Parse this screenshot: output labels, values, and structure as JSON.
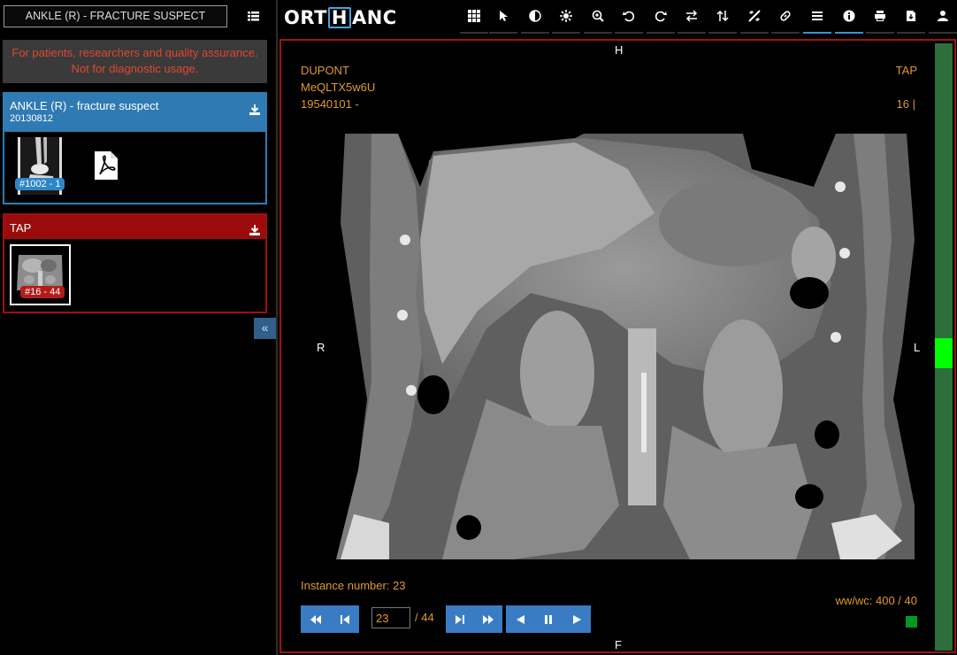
{
  "sidebar": {
    "study_title": "ANKLE (R) - FRACTURE SUSPECT",
    "disclaimer": "For patients, researchers and quality assurance. Not for diagnostic usage.",
    "studies": [
      {
        "description": "ANKLE (R) - fracture suspect",
        "date": "20130812",
        "color": "#2f7ab3",
        "series": [
          {
            "badge": "#1002 - 1",
            "kind": "x-ray-thumbnail"
          },
          {
            "badge": "",
            "kind": "pdf-icon"
          }
        ]
      },
      {
        "description": "TAP",
        "date": "",
        "color": "#9a0b0b",
        "series": [
          {
            "badge": "#16 - 44",
            "kind": "ct-thumbnail"
          }
        ]
      }
    ],
    "collapse_label": "«"
  },
  "toolbar": {
    "logo_left": "ORT",
    "logo_boxed": "H",
    "logo_right": "ANC",
    "tools": [
      "layout-grid-icon",
      "pointer-icon",
      "contrast-icon",
      "pan-icon",
      "zoom-icon",
      "rotate-left-icon",
      "rotate-right-icon",
      "flip-horizontal-icon",
      "flip-vertical-icon",
      "measure-icon",
      "link-icon",
      "menu-icon",
      "info-icon",
      "print-icon",
      "download-file-icon",
      "user-icon"
    ],
    "active_tools": [
      "menu-icon",
      "info-icon"
    ]
  },
  "viewer": {
    "orientation": {
      "top": "H",
      "bottom": "F",
      "left": "R",
      "right": "L"
    },
    "patient_name": "DUPONT",
    "patient_id": "MeQLTX5w6U",
    "birth_date": "19540101 -",
    "series_description": "TAP",
    "series_number": "16 |",
    "instance_label": "Instance number: 23",
    "window_level": "ww/wc: 400 / 40",
    "frame_value": "23",
    "frame_total": "/ 44",
    "slider_position_fraction": 0.5
  },
  "colors": {
    "overlay_text": "#e09a2b",
    "active_border": "#a01414",
    "accent_blue": "#3a7cc4",
    "slider_green": "#2d6e3a"
  }
}
